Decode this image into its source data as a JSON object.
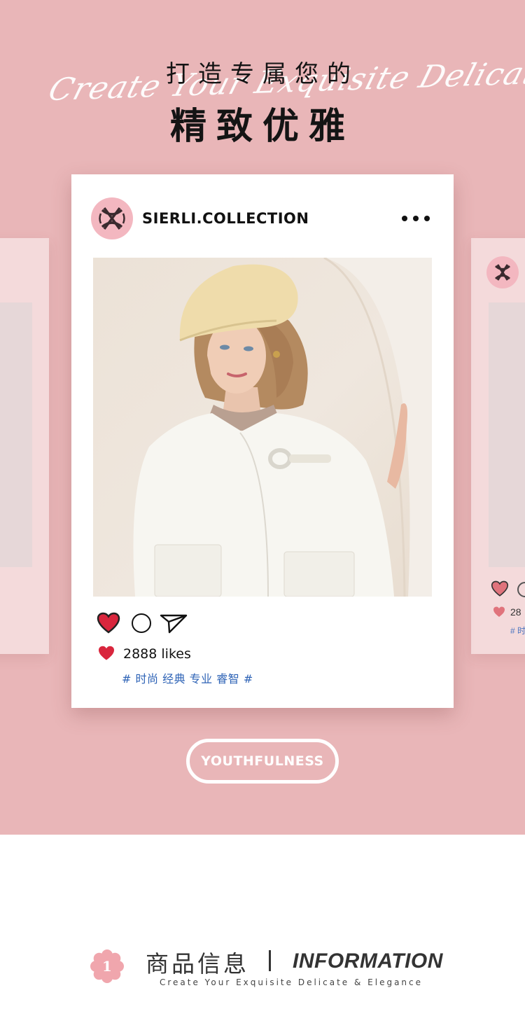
{
  "hero": {
    "script_text": "Create Your Exquisite Delicate & Elegance",
    "headline_line1": "打造专属您的",
    "headline_line2": "精致优雅",
    "background_color": "#e9b6b8"
  },
  "post": {
    "account_name": "SIERLI.COLLECTION",
    "likes_text": "2888 likes",
    "tags": "# 时尚 经典 专业 睿智 #",
    "heart_color": "#d9263d",
    "tag_color": "#2e63b6"
  },
  "ghost_right": {
    "likes_text": "28",
    "tags": "# 时"
  },
  "badge": {
    "label": "YOUTHFULNESS"
  },
  "info_section": {
    "badge_number": "1",
    "title_cn": "商品信息",
    "title_en": "INFORMATION",
    "subtitle": "Create Your Exquisite Delicate & Elegance",
    "accent_color": "#f0a6ad"
  }
}
